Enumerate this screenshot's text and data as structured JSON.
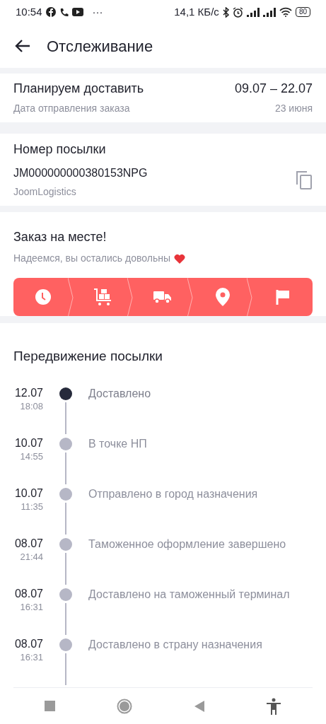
{
  "status_bar": {
    "time": "10:54",
    "more": "···",
    "speed": "14,1 КБ/с",
    "battery": "80"
  },
  "header": {
    "title": "Отслеживание"
  },
  "delivery": {
    "title": "Планируем доставить",
    "subtitle": "Дата отправления заказа",
    "range": "09.07 – 22.07",
    "date": "23 июня"
  },
  "parcel": {
    "title": "Номер посылки",
    "number": "JM000000000380153NPG",
    "carrier": "JoomLogistics"
  },
  "status": {
    "title": "Заказ на месте!",
    "subtitle": "Надеемся, вы остались довольны",
    "steps": [
      {
        "kind": "clock",
        "done": true
      },
      {
        "kind": "cart",
        "done": true
      },
      {
        "kind": "truck",
        "done": true
      },
      {
        "kind": "pin",
        "done": true
      },
      {
        "kind": "flag",
        "done": true
      }
    ]
  },
  "movement": {
    "title": "Передвижение посылки",
    "events": [
      {
        "date": "12.07",
        "time": "18:08",
        "text": "Доставлено",
        "current": true
      },
      {
        "date": "10.07",
        "time": "14:55",
        "text": "В точке НП",
        "current": false
      },
      {
        "date": "10.07",
        "time": "11:35",
        "text": "Отправлено в город назначения",
        "current": false
      },
      {
        "date": "08.07",
        "time": "21:44",
        "text": "Таможенное оформление завершено",
        "current": false
      },
      {
        "date": "08.07",
        "time": "16:31",
        "text": "Доставлено на таможенный терминал",
        "current": false
      },
      {
        "date": "08.07",
        "time": "16:31",
        "text": "Доставлено в страну назначения",
        "current": false
      }
    ]
  }
}
